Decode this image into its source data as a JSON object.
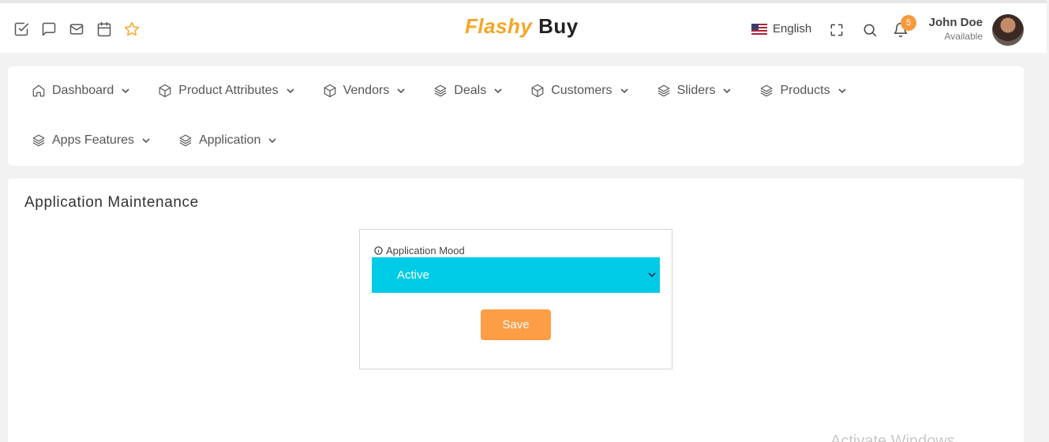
{
  "header": {
    "brand_part1": "Flashy",
    "brand_part2": "Buy",
    "language": "English",
    "notification_count": "5",
    "user_name": "John Doe",
    "user_status": "Available",
    "left_icons": [
      "checkbox-icon",
      "chat-icon",
      "mail-icon",
      "calendar-icon",
      "star-icon"
    ]
  },
  "nav": {
    "row1": [
      {
        "label": "Dashboard",
        "icon": "home-icon"
      },
      {
        "label": "Product Attributes",
        "icon": "box-icon"
      },
      {
        "label": "Vendors",
        "icon": "box-icon"
      },
      {
        "label": "Deals",
        "icon": "layers-icon"
      },
      {
        "label": "Customers",
        "icon": "box-icon"
      },
      {
        "label": "Sliders",
        "icon": "layers-icon"
      },
      {
        "label": "Products",
        "icon": "layers-icon"
      }
    ],
    "row2": [
      {
        "label": "Apps Features",
        "icon": "layers-icon"
      },
      {
        "label": "Application",
        "icon": "layers-icon"
      }
    ]
  },
  "main": {
    "title": "Application Maintenance",
    "field_label": "Application Mood",
    "selected_value": "Active",
    "save_label": "Save"
  },
  "watermark": "Activate Windows",
  "colors": {
    "brand_accent": "#f5a623",
    "select_bg": "#00cbe6",
    "save_bg": "#fd9d46",
    "badge_bg": "#f79a3e"
  }
}
